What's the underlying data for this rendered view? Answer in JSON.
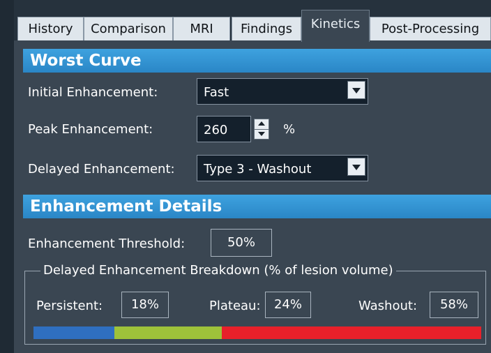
{
  "tabs": [
    {
      "label": "History",
      "active": false
    },
    {
      "label": "Comparison",
      "active": false
    },
    {
      "label": "MRI",
      "active": false
    },
    {
      "label": "Findings",
      "active": false
    },
    {
      "label": "Kinetics",
      "active": true
    },
    {
      "label": "Post-Processing",
      "active": false
    }
  ],
  "worst_curve": {
    "title": "Worst Curve",
    "initial_label": "Initial Enhancement:",
    "initial_value": "Fast",
    "peak_label": "Peak Enhancement:",
    "peak_value": "260",
    "peak_unit": "%",
    "delayed_label": "Delayed Enhancement:",
    "delayed_value": "Type 3 - Washout"
  },
  "enhancement_details": {
    "title": "Enhancement Details",
    "threshold_label": "Enhancement Threshold:",
    "threshold_value": "50%",
    "breakdown_title": "Delayed Enhancement Breakdown (% of lesion volume)",
    "persistent_label": "Persistent:",
    "persistent_value": "18%",
    "plateau_label": "Plateau:",
    "plateau_value": "24%",
    "washout_label": "Washout:",
    "washout_value": "58%"
  },
  "breakdown_bar": [
    {
      "name": "persistent",
      "fraction": 0.18,
      "color": "#2f6fc0"
    },
    {
      "name": "plateau",
      "fraction": 0.24,
      "color": "#9ec23a"
    },
    {
      "name": "washout",
      "fraction": 0.58,
      "color": "#e8202a"
    }
  ],
  "colors": {
    "panel_bg": "#3a4652",
    "header_blue": "#3398d6",
    "field_bg": "#14202c"
  }
}
